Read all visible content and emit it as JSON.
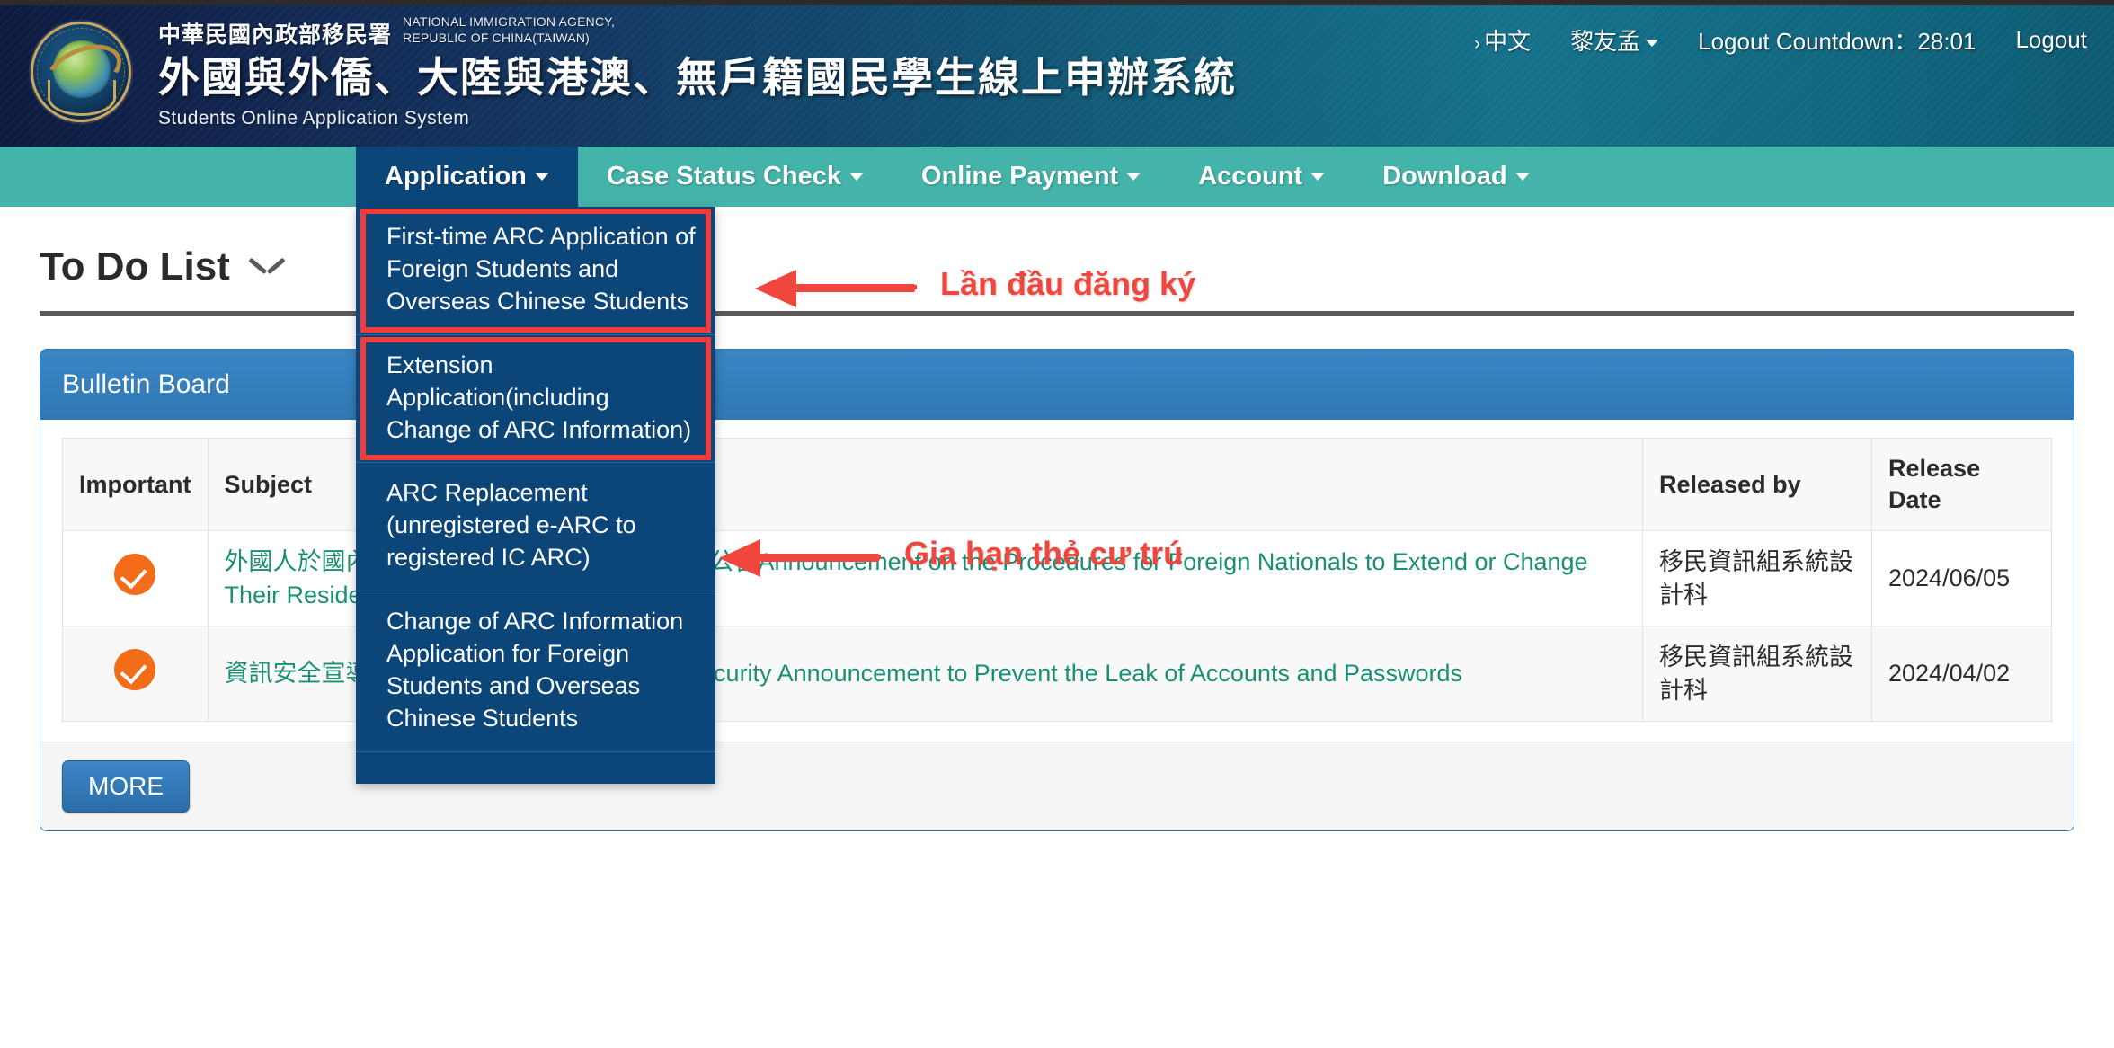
{
  "header": {
    "org_zh": "中華民國內政部移民署",
    "org_en_line1": "NATIONAL IMMIGRATION AGENCY,",
    "org_en_line2": "REPUBLIC OF CHINA(TAIWAN)",
    "system_zh": "外國與外僑、大陸與港澳、無戶籍國民學生線上申辦系統",
    "system_en": "Students Online Application System",
    "tools": {
      "language": "中文",
      "chevron": "›",
      "username": "黎友孟",
      "countdown": "Logout Countdown：28:01",
      "logout": "Logout"
    },
    "colors": {
      "header_dark": "#0d1a3e",
      "header_teal": "#15718b",
      "navbar": "#44b3aa",
      "nav_active": "#0c4578"
    }
  },
  "nav": {
    "items": [
      {
        "label": "Application",
        "active": true
      },
      {
        "label": "Case Status Check",
        "active": false
      },
      {
        "label": "Online Payment",
        "active": false
      },
      {
        "label": "Account",
        "active": false
      },
      {
        "label": "Download",
        "active": false
      }
    ]
  },
  "dropdown": {
    "open_for": "Application",
    "items": [
      {
        "label": "First-time ARC Application of Foreign Students and Overseas Chinese Students",
        "highlighted": true
      },
      {
        "label": "Extension Application(including Change of ARC Information)",
        "highlighted": true
      },
      {
        "label": "ARC Replacement (unregistered e-ARC to registered IC ARC)",
        "highlighted": false
      },
      {
        "label": "Change of ARC Information Application for Foreign Students and Overseas Chinese Students",
        "highlighted": false
      }
    ]
  },
  "annotations": [
    {
      "text": "Lần đầu đăng ký",
      "color": "#f0463e"
    },
    {
      "text": "Gia hạn thẻ cư trú",
      "color": "#f0463e"
    }
  ],
  "todo": {
    "title": "To Do List",
    "chevron_icon": "chevron-down-icon"
  },
  "bulletin": {
    "panel_title": "Bulletin Board",
    "columns": [
      "Important",
      "Subject",
      "Released by",
      "Release Date"
    ],
    "rows": [
      {
        "important": "important-check-icon",
        "subject": "外國人於國內外申辦居留延期或變更申辦方式公告Announcement on the Procedures for Foreign Nationals to Extend or Change Their Residency Locally and Abroad",
        "released_by": "移民資訊組系統設計科",
        "release_date": "2024/06/05"
      },
      {
        "important": "important-check-icon",
        "subject": "資訊安全宣導，防止帳號及密碼外洩Cyber Security Announcement to Prevent the Leak of Accounts and Passwords",
        "released_by": "移民資訊組系統設計科",
        "release_date": "2024/04/02"
      }
    ],
    "more_label": "MORE"
  }
}
